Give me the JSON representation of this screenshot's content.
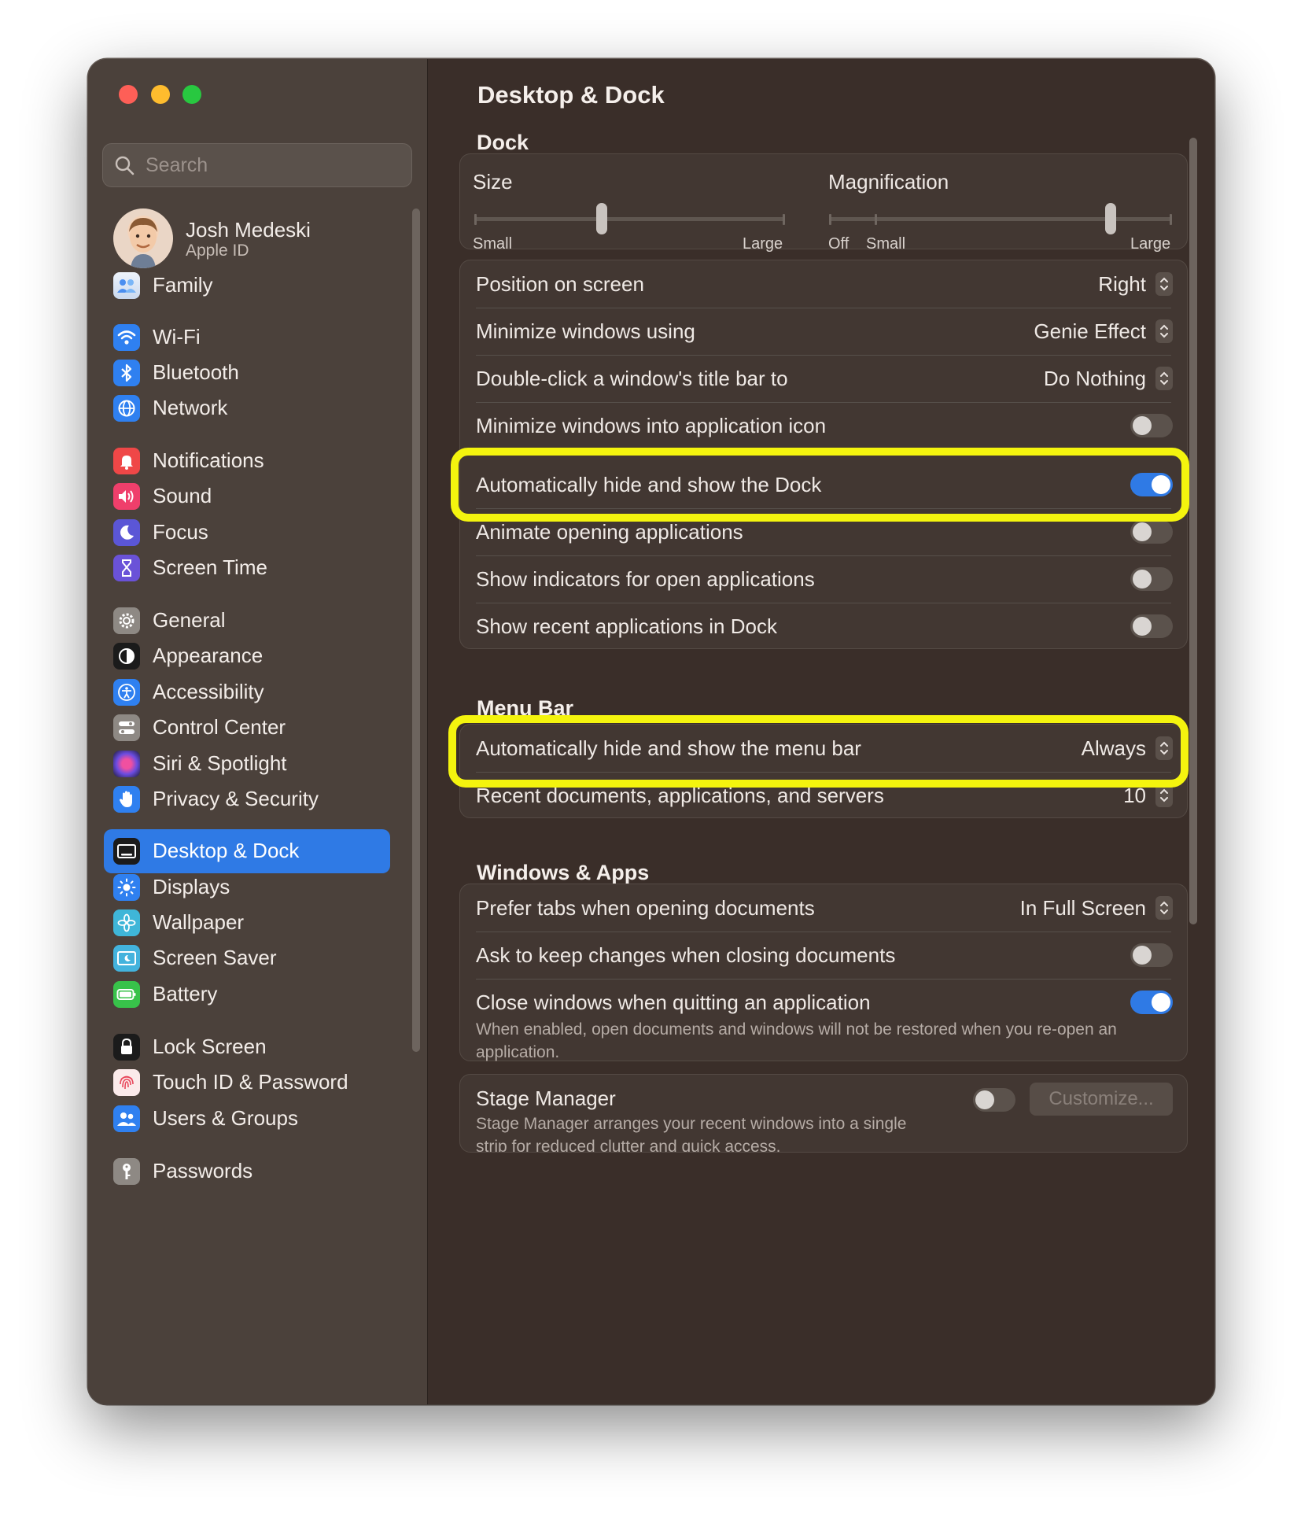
{
  "sidebar": {
    "search_placeholder": "Search",
    "user": {
      "name": "Josh Medeski",
      "subtitle": "Apple ID"
    },
    "items": [
      {
        "label": "Family"
      },
      {
        "label": "Wi-Fi"
      },
      {
        "label": "Bluetooth"
      },
      {
        "label": "Network"
      },
      {
        "label": "Notifications"
      },
      {
        "label": "Sound"
      },
      {
        "label": "Focus"
      },
      {
        "label": "Screen Time"
      },
      {
        "label": "General"
      },
      {
        "label": "Appearance"
      },
      {
        "label": "Accessibility"
      },
      {
        "label": "Control Center"
      },
      {
        "label": "Siri & Spotlight"
      },
      {
        "label": "Privacy & Security"
      },
      {
        "label": "Desktop & Dock",
        "selected": true
      },
      {
        "label": "Displays"
      },
      {
        "label": "Wallpaper"
      },
      {
        "label": "Screen Saver"
      },
      {
        "label": "Battery"
      },
      {
        "label": "Lock Screen"
      },
      {
        "label": "Touch ID & Password"
      },
      {
        "label": "Users & Groups"
      },
      {
        "label": "Passwords"
      }
    ]
  },
  "main": {
    "title": "Desktop & Dock",
    "dock": {
      "section_title": "Dock",
      "size": {
        "label": "Size",
        "min_label": "Small",
        "max_label": "Large",
        "value": 0.41
      },
      "magnification": {
        "label": "Magnification",
        "off_label": "Off",
        "min_label": "Small",
        "max_label": "Large",
        "value": 0.82
      },
      "rows": [
        {
          "label": "Position on screen",
          "value": "Right"
        },
        {
          "label": "Minimize windows using",
          "value": "Genie Effect"
        },
        {
          "label": "Double-click a window's title bar to",
          "value": "Do Nothing"
        },
        {
          "label": "Minimize windows into application icon",
          "toggle": false
        },
        {
          "label": "Automatically hide and show the Dock",
          "toggle": true
        },
        {
          "label": "Animate opening applications",
          "toggle": false
        },
        {
          "label": "Show indicators for open applications",
          "toggle": false
        },
        {
          "label": "Show recent applications in Dock",
          "toggle": false
        }
      ]
    },
    "menu_bar": {
      "section_title": "Menu Bar",
      "rows": [
        {
          "label": "Automatically hide and show the menu bar",
          "value": "Always"
        },
        {
          "label": "Recent documents, applications, and servers",
          "value": "10"
        }
      ]
    },
    "windows_apps": {
      "section_title": "Windows & Apps",
      "rows": [
        {
          "label": "Prefer tabs when opening documents",
          "value": "In Full Screen"
        },
        {
          "label": "Ask to keep changes when closing documents",
          "toggle": false
        },
        {
          "label": "Close windows when quitting an application",
          "toggle": true,
          "description": "When enabled, open documents and windows will not be restored when you re-open an application."
        }
      ]
    },
    "stage_manager": {
      "label": "Stage Manager",
      "toggle": false,
      "button_label": "Customize...",
      "description": "Stage Manager arranges your recent windows into a single strip for reduced clutter and quick access."
    }
  },
  "colors": {
    "accent": "#2f7ae5",
    "highlight": "#f4f40e"
  }
}
